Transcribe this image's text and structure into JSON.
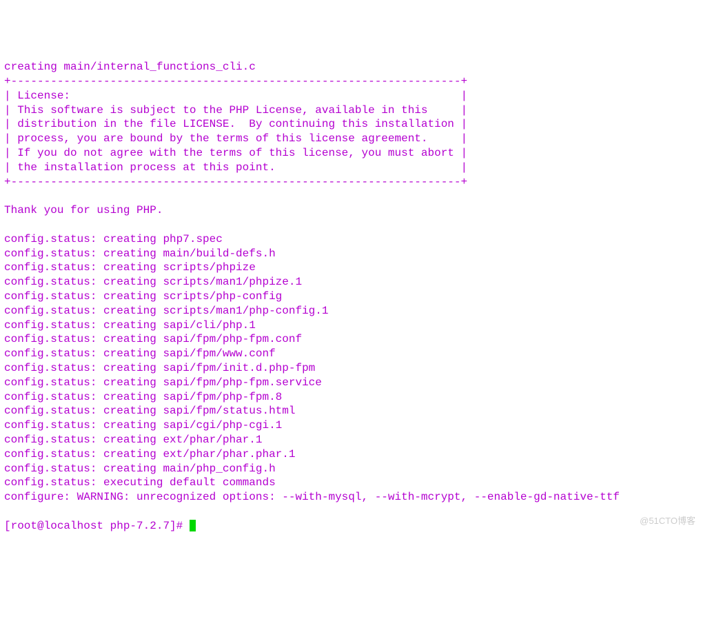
{
  "terminal": {
    "lines": [
      "creating main/internal_functions_cli.c",
      "+--------------------------------------------------------------------+",
      "| License:                                                           |",
      "| This software is subject to the PHP License, available in this     |",
      "| distribution in the file LICENSE.  By continuing this installation |",
      "| process, you are bound by the terms of this license agreement.     |",
      "| If you do not agree with the terms of this license, you must abort |",
      "| the installation process at this point.                            |",
      "+--------------------------------------------------------------------+",
      "",
      "Thank you for using PHP.",
      "",
      "config.status: creating php7.spec",
      "config.status: creating main/build-defs.h",
      "config.status: creating scripts/phpize",
      "config.status: creating scripts/man1/phpize.1",
      "config.status: creating scripts/php-config",
      "config.status: creating scripts/man1/php-config.1",
      "config.status: creating sapi/cli/php.1",
      "config.status: creating sapi/fpm/php-fpm.conf",
      "config.status: creating sapi/fpm/www.conf",
      "config.status: creating sapi/fpm/init.d.php-fpm",
      "config.status: creating sapi/fpm/php-fpm.service",
      "config.status: creating sapi/fpm/php-fpm.8",
      "config.status: creating sapi/fpm/status.html",
      "config.status: creating sapi/cgi/php-cgi.1",
      "config.status: creating ext/phar/phar.1",
      "config.status: creating ext/phar/phar.phar.1",
      "config.status: creating main/php_config.h",
      "config.status: executing default commands",
      "configure: WARNING: unrecognized options: --with-mysql, --with-mcrypt, --enable-gd-native-ttf"
    ],
    "prompt": "[root@localhost php-7.2.7]# "
  },
  "watermark": "@51CTO博客"
}
